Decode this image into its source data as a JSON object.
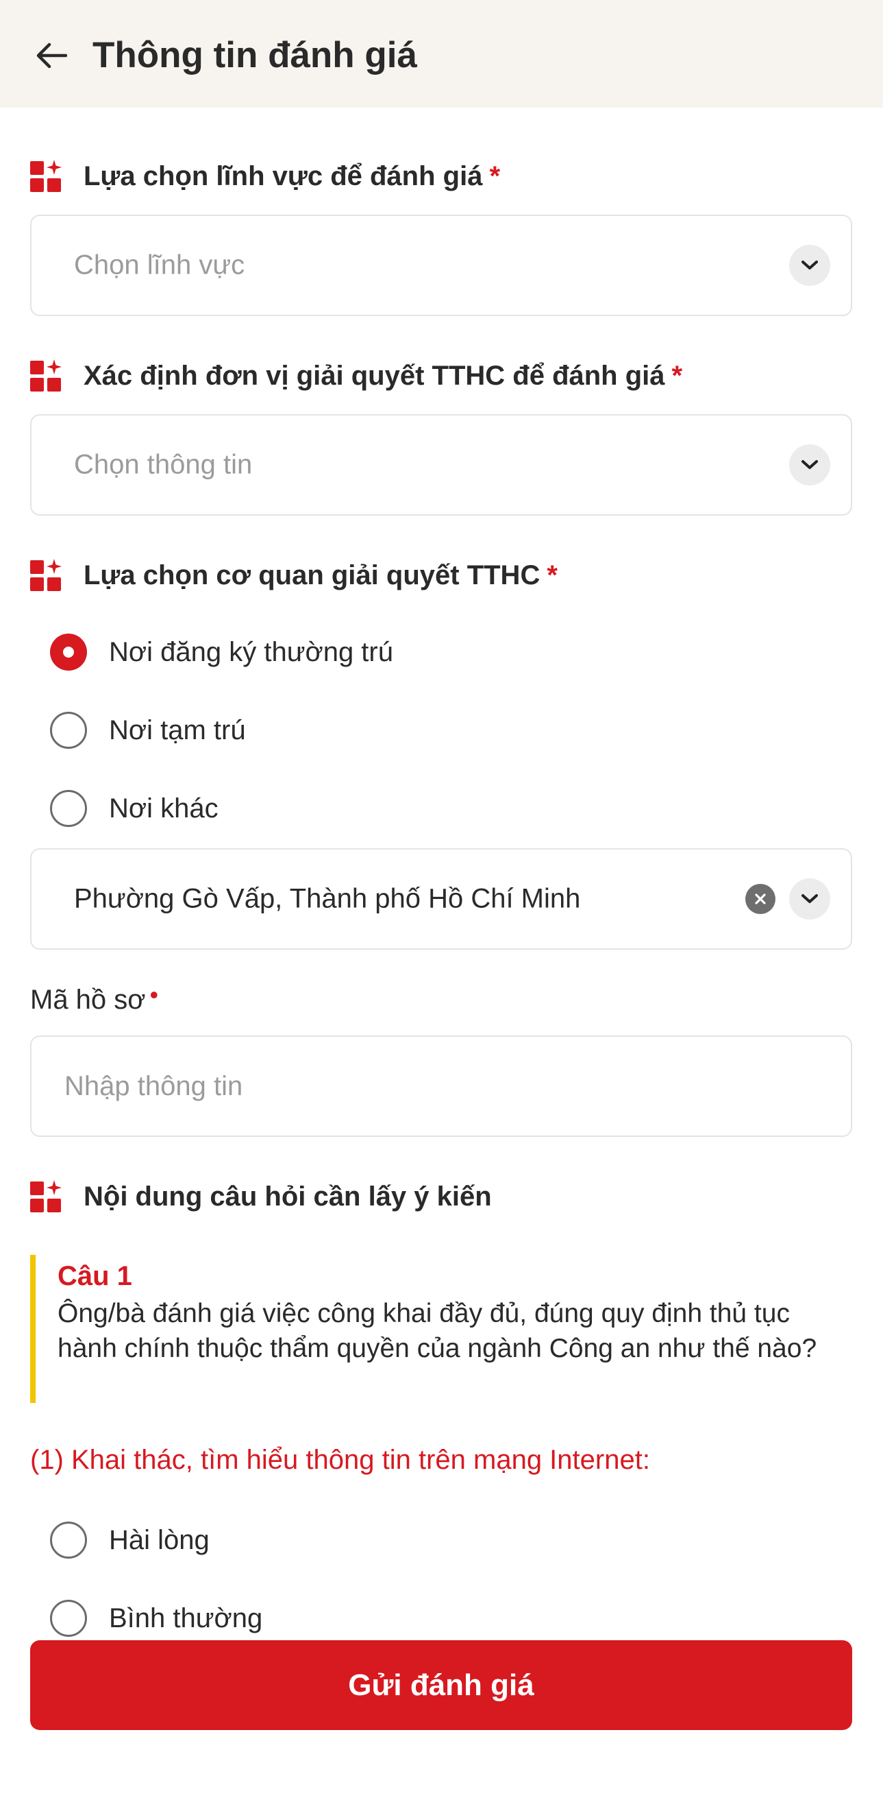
{
  "header": {
    "title": "Thông tin đánh giá"
  },
  "sections": {
    "field_select": {
      "label": "Lựa chọn lĩnh vực để đánh giá",
      "required_mark": "*",
      "placeholder": "Chọn lĩnh vực"
    },
    "unit_select": {
      "label": "Xác định đơn vị giải quyết TTHC để đánh giá",
      "required_mark": "*",
      "placeholder": "Chọn thông tin"
    },
    "agency": {
      "label": "Lựa chọn cơ quan giải quyết TTHC",
      "required_mark": "*",
      "options": [
        {
          "label": "Nơi đăng ký thường trú",
          "checked": true
        },
        {
          "label": "Nơi tạm trú",
          "checked": false
        },
        {
          "label": "Nơi khác",
          "checked": false
        }
      ],
      "location_value": "Phường Gò Vấp, Thành phố Hồ Chí Minh"
    },
    "record_code": {
      "label": "Mã hồ sơ",
      "required_mark": "•",
      "placeholder": "Nhập thông tin"
    },
    "questions": {
      "label": "Nội dung câu hỏi cần lấy ý kiến",
      "items": [
        {
          "title": "Câu 1",
          "text": "Ông/bà đánh giá việc công khai đầy đủ, đúng quy định thủ tục hành chính thuộc thẩm quyền của ngành Công an như thế nào?",
          "sub_question": "(1) Khai thác, tìm hiểu thông tin trên mạng Internet:",
          "options": [
            {
              "label": "Hài lòng",
              "checked": false
            },
            {
              "label": "Bình thường",
              "checked": false
            }
          ]
        }
      ]
    }
  },
  "footer": {
    "submit_label": "Gửi đánh giá"
  },
  "colors": {
    "accent": "#d71920",
    "question_bar": "#f2c500",
    "header_bg": "#f7f4ef"
  },
  "icons": [
    "back-arrow-icon",
    "section-grid-icon",
    "chevron-down-icon",
    "clear-icon"
  ]
}
